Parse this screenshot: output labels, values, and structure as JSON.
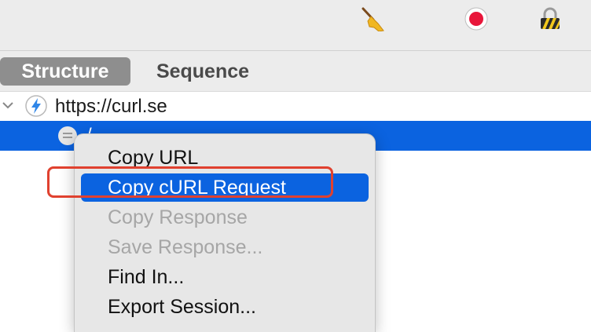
{
  "toolbar": {
    "icons": [
      "broom-icon",
      "record-icon",
      "lock-icon"
    ]
  },
  "tabs": [
    {
      "label": "Structure",
      "active": true
    },
    {
      "label": "Sequence",
      "active": false
    }
  ],
  "tree": {
    "host": "https://curl.se",
    "child": "/"
  },
  "context_menu": {
    "items": [
      {
        "label": "Copy URL",
        "state": "normal"
      },
      {
        "label": "Copy cURL Request",
        "state": "highlighted"
      },
      {
        "label": "Copy Response",
        "state": "disabled"
      },
      {
        "label": "Save Response...",
        "state": "disabled"
      },
      {
        "label": "Find In...",
        "state": "normal"
      },
      {
        "label": "Export Session...",
        "state": "normal"
      }
    ]
  },
  "colors": {
    "selection": "#0b63e0",
    "annotation": "#e0412f",
    "record": "#e8163a"
  }
}
